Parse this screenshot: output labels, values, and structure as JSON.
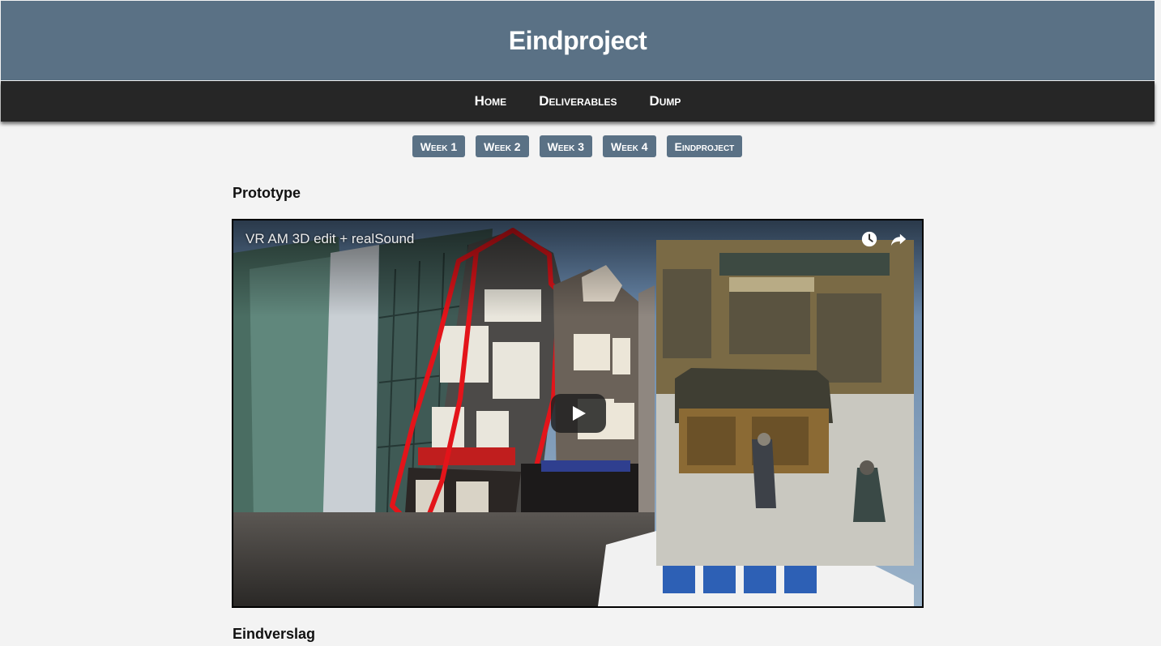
{
  "header": {
    "title": "Eindproject"
  },
  "nav": {
    "items": [
      {
        "label": "Home"
      },
      {
        "label": "Deliverables"
      },
      {
        "label": "Dump"
      }
    ]
  },
  "weeks": {
    "tabs": [
      {
        "label": "Week 1"
      },
      {
        "label": "Week 2"
      },
      {
        "label": "Week 3"
      },
      {
        "label": "Week 4"
      },
      {
        "label": "Eindproject"
      }
    ]
  },
  "sections": {
    "prototype": "Prototype",
    "eindverslag": "Eindverslag"
  },
  "video": {
    "title": "VR AM 3D edit + realSound",
    "icons": [
      "watch-later-icon",
      "share-icon",
      "play-icon"
    ]
  },
  "colors": {
    "header_bg": "#5a7185",
    "nav_bg": "#262626",
    "page_bg": "#f3f3f3",
    "tab_bg": "#5a7185"
  }
}
